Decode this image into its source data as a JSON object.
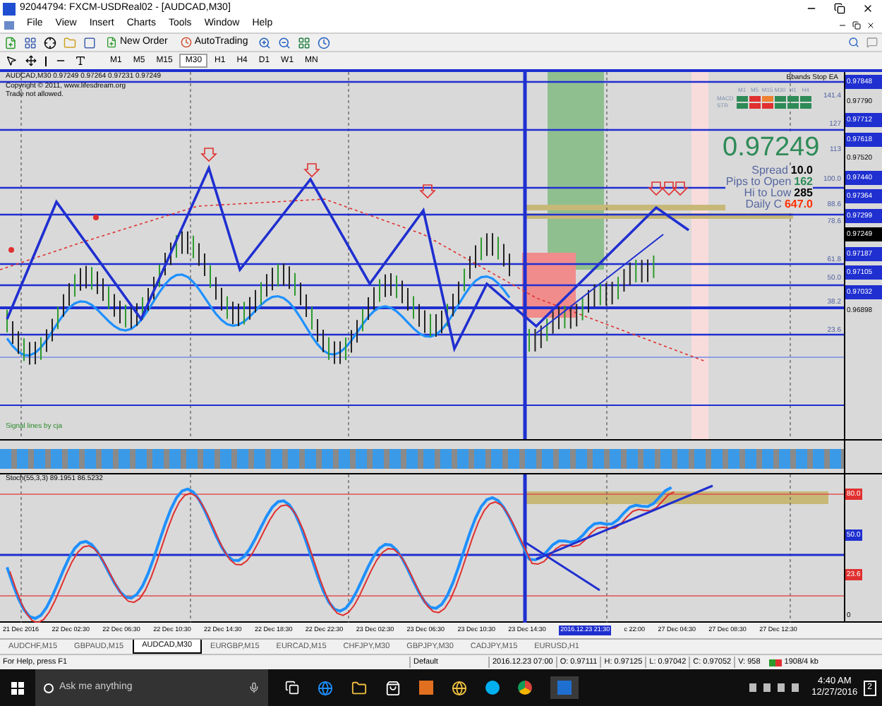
{
  "window": {
    "title": "92044794: FXCM-USDReal02 - [AUDCAD,M30]"
  },
  "menu": [
    "File",
    "View",
    "Insert",
    "Charts",
    "Tools",
    "Window",
    "Help"
  ],
  "toolbar": {
    "buttons": [
      "New Order",
      "AutoTrading"
    ]
  },
  "timeframes": [
    {
      "label": "M1",
      "selected": false
    },
    {
      "label": "M5",
      "selected": false
    },
    {
      "label": "M15",
      "selected": false
    },
    {
      "label": "M30",
      "selected": true
    },
    {
      "label": "H1",
      "selected": false
    },
    {
      "label": "H4",
      "selected": false
    },
    {
      "label": "D1",
      "selected": false
    },
    {
      "label": "W1",
      "selected": false
    },
    {
      "label": "MN",
      "selected": false
    }
  ],
  "chart": {
    "header": "AUDCAD,M30 0.97249 0.97264 0.97231 0.97249",
    "copyright": "Copyright © 2011, www.lifesdream.org",
    "notice": "Trade not allowed.",
    "ea_label": "Bbands Stop EA",
    "signal_label": "Signal lines by cja",
    "trend_grid": {
      "timeframes": [
        "M1",
        "M5",
        "M15",
        "M30",
        "H1",
        "H4"
      ],
      "rows": [
        {
          "label": "MACD",
          "cells": [
            {
              "color": "#2e8b57"
            },
            {
              "color": "#e03030"
            },
            {
              "color": "#f08030"
            },
            {
              "color": "#2e8b57"
            },
            {
              "color": "#2e8b57"
            },
            {
              "color": "#2e8b57"
            }
          ]
        },
        {
          "label": "STR",
          "cells": [
            {
              "color": "#2e8b57"
            },
            {
              "color": "#e03030"
            },
            {
              "color": "#e03030"
            },
            {
              "color": "#2e8b57"
            },
            {
              "color": "#2e8b57"
            },
            {
              "color": "#2e8b57"
            }
          ]
        }
      ]
    },
    "price": "0.97249",
    "stats": [
      {
        "label": "Spread",
        "value": "10.0",
        "kind": "neutral"
      },
      {
        "label": "Pips to Open",
        "value": "162",
        "kind": "up"
      },
      {
        "label": "Hi to Low",
        "value": "285",
        "kind": "neutral"
      },
      {
        "label": "Daily C",
        "value": "647.0",
        "kind": "down"
      }
    ],
    "fibo_levels": [
      "141.4",
      "127",
      "113",
      "100.0",
      "88.6",
      "78.6",
      "61.8",
      "50.0",
      "38.2",
      "23.6"
    ],
    "price_axis": [
      {
        "label": "0.97848",
        "kind": "line"
      },
      {
        "label": "0.97790",
        "kind": "plain"
      },
      {
        "label": "0.97712",
        "kind": "line"
      },
      {
        "label": "0.97618",
        "kind": "line"
      },
      {
        "label": "0.97520",
        "kind": "plain"
      },
      {
        "label": "0.97440",
        "kind": "line"
      },
      {
        "label": "0.97364",
        "kind": "line"
      },
      {
        "label": "0.97299",
        "kind": "line"
      },
      {
        "label": "0.97249",
        "kind": "current"
      },
      {
        "label": "0.97187",
        "kind": "line"
      },
      {
        "label": "0.97105",
        "kind": "line"
      },
      {
        "label": "0.97032",
        "kind": "line"
      },
      {
        "label": "0.96898",
        "kind": "plain"
      }
    ]
  },
  "stoch": {
    "label": "Stoch(55,3,3) 89.1951 86.5232",
    "axis": [
      {
        "label": "80.0",
        "kind": "level"
      },
      {
        "label": "50.0",
        "kind": "line"
      },
      {
        "label": "23.6",
        "kind": "level"
      },
      {
        "label": "0",
        "kind": "plain"
      }
    ]
  },
  "time_axis": [
    {
      "label": "21 Dec 2016",
      "highlighted": false
    },
    {
      "label": "22 Dec 02:30",
      "highlighted": false
    },
    {
      "label": "22 Dec 06:30",
      "highlighted": false
    },
    {
      "label": "22 Dec 10:30",
      "highlighted": false
    },
    {
      "label": "22 Dec 14:30",
      "highlighted": false
    },
    {
      "label": "22 Dec 18:30",
      "highlighted": false
    },
    {
      "label": "22 Dec 22:30",
      "highlighted": false
    },
    {
      "label": "23 Dec 02:30",
      "highlighted": false
    },
    {
      "label": "23 Dec 06:30",
      "highlighted": false
    },
    {
      "label": "23 Dec 10:30",
      "highlighted": false
    },
    {
      "label": "23 Dec 14:30",
      "highlighted": false
    },
    {
      "label": "2016.12.23 21:30",
      "highlighted": true
    },
    {
      "label": "c 22:00",
      "highlighted": false
    },
    {
      "label": "27 Dec 04:30",
      "highlighted": false
    },
    {
      "label": "27 Dec 08:30",
      "highlighted": false
    },
    {
      "label": "27 Dec 12:30",
      "highlighted": false
    }
  ],
  "tabs": [
    {
      "label": "AUDCHF,M15",
      "selected": false
    },
    {
      "label": "GBPAUD,M15",
      "selected": false
    },
    {
      "label": "AUDCAD,M30",
      "selected": true
    },
    {
      "label": "EURGBP,M15",
      "selected": false
    },
    {
      "label": "EURCAD,M15",
      "selected": false
    },
    {
      "label": "CHFJPY,M30",
      "selected": false
    },
    {
      "label": "GBPJPY,M30",
      "selected": false
    },
    {
      "label": "CADJPY,M15",
      "selected": false
    },
    {
      "label": "EURUSD,H1",
      "selected": false
    }
  ],
  "status_bar": {
    "help": "For Help, press F1",
    "profile": "Default",
    "fields": [
      "2016.12.23 07:00",
      "O: 0.97111",
      "H: 0.97125",
      "L: 0.97042",
      "C: 0.97052",
      "V: 958"
    ],
    "traffic": "1908/4 kb"
  },
  "taskbar": {
    "search_placeholder": "Ask me anything",
    "time": "4:40 AM",
    "date": "12/27/2016",
    "notifications": "2"
  }
}
